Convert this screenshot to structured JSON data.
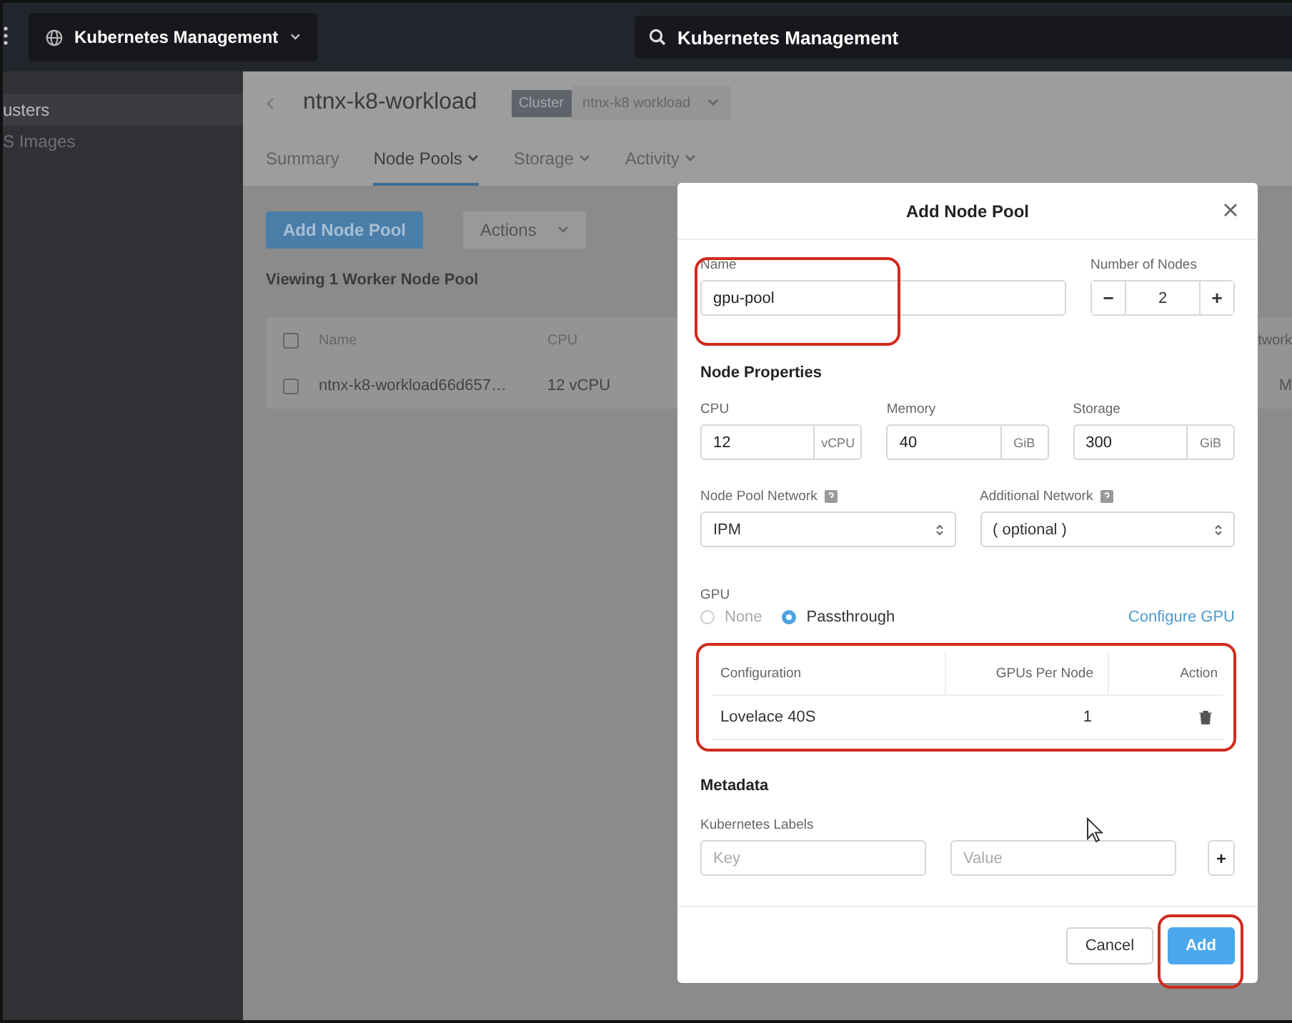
{
  "app_bar": {
    "app_selector": "Kubernetes Management",
    "search": {
      "value": "Kubernetes Management"
    }
  },
  "sidebar": {
    "items": [
      {
        "label": "usters",
        "selected": true
      },
      {
        "label": "S Images",
        "selected": false
      }
    ]
  },
  "header": {
    "title": "ntnx-k8-workload",
    "badge": "Cluster",
    "cluster": "ntnx-k8 workload"
  },
  "tabs": [
    {
      "label": "Summary",
      "selected": false,
      "dropdown": false
    },
    {
      "label": "Node Pools",
      "selected": true,
      "dropdown": true
    },
    {
      "label": "Storage",
      "selected": false,
      "dropdown": true
    },
    {
      "label": "Activity",
      "selected": false,
      "dropdown": true
    }
  ],
  "toolbar": {
    "add_button": "Add Node Pool",
    "actions": {
      "label": "Actions",
      "disabled": true
    }
  },
  "summary": "Viewing 1 Worker Node Pool",
  "table": {
    "select_all": false,
    "columns": [
      "Name",
      "CPU",
      "twork"
    ],
    "rows": [
      {
        "checked": false,
        "cells": [
          "ntnx-k8-workload66d657…",
          "12 vCPU",
          "M"
        ]
      }
    ]
  },
  "dialog": {
    "title": "Add Node Pool",
    "name": {
      "label": "Name",
      "value": "gpu-pool"
    },
    "nodes": {
      "label": "Number of Nodes",
      "value": "2",
      "decrement": "−",
      "increment": "+"
    },
    "node_properties": "Node Properties",
    "resources": [
      {
        "label": "CPU",
        "value": "12",
        "unit": "vCPU"
      },
      {
        "label": "Memory",
        "value": "40",
        "unit": "GiB"
      },
      {
        "label": "Storage",
        "value": "300",
        "unit": "GiB"
      }
    ],
    "networks": [
      {
        "label": "Node Pool Network",
        "value": "IPM"
      },
      {
        "label": "Additional Network",
        "value": "( optional )"
      }
    ],
    "gpu": {
      "label": "GPU",
      "options": [
        {
          "label": "None",
          "selected": false,
          "disabled": true
        },
        {
          "label": "Passthrough",
          "selected": true,
          "disabled": false
        }
      ],
      "link": "Configure GPU"
    },
    "gpu_table": {
      "columns": [
        "Configuration",
        "GPUs Per Node",
        "Action"
      ],
      "rows": [
        {
          "configuration": "Lovelace 40S",
          "gpus": "1"
        }
      ]
    },
    "metadata": {
      "heading": "Metadata",
      "labels": "Kubernetes Labels",
      "key_placeholder": "Key",
      "value_placeholder": "Value",
      "add": "+"
    },
    "buttons": [
      {
        "label": "Cancel",
        "kind": "secondary"
      },
      {
        "label": "Add",
        "kind": "primary"
      }
    ]
  }
}
